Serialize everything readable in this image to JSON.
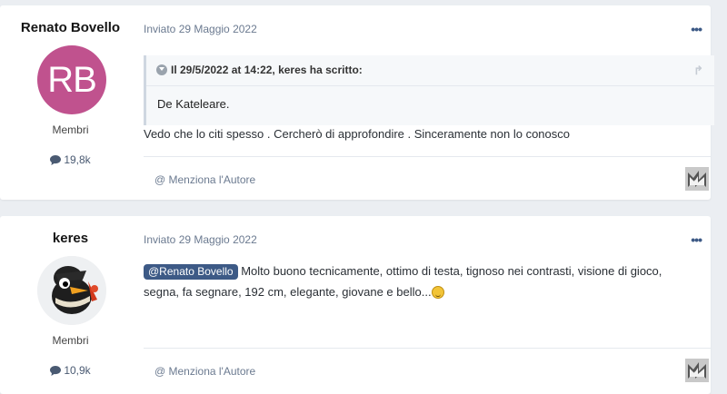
{
  "posts": [
    {
      "author": "Renato Bovello",
      "avatar_initials": "RB",
      "avatar_color": "#c0528e",
      "group": "Membri",
      "post_count": "19,8k",
      "date": "Inviato 29 Maggio 2022",
      "quote": {
        "header": "Il 29/5/2022 at 14:22, keres ha scritto:",
        "body": "De Kateleare."
      },
      "text": "Vedo che lo citi spesso . Cercherò di approfondire . Sinceramente non lo conosco",
      "mention_author": "@ Menziona l'Autore"
    },
    {
      "author": "keres",
      "group": "Membri",
      "post_count": "10,9k",
      "date": "Inviato 29 Maggio 2022",
      "mention": "@Renato Bovello",
      "text": " Molto buono tecnicamente, ottimo di testa, tignoso nei contrasti, visione di gioco, segna, fa segnare, 192 cm, elegante, giovane e bello...",
      "mention_author": "@ Menziona l'Autore"
    }
  ],
  "icons": {
    "comment": "comment-icon",
    "menu": "ellipsis-icon",
    "share": "share-icon",
    "site_logo": "site-logo-icon"
  },
  "colors": {
    "accent": "#3d5a86",
    "background": "#ebeef2"
  }
}
